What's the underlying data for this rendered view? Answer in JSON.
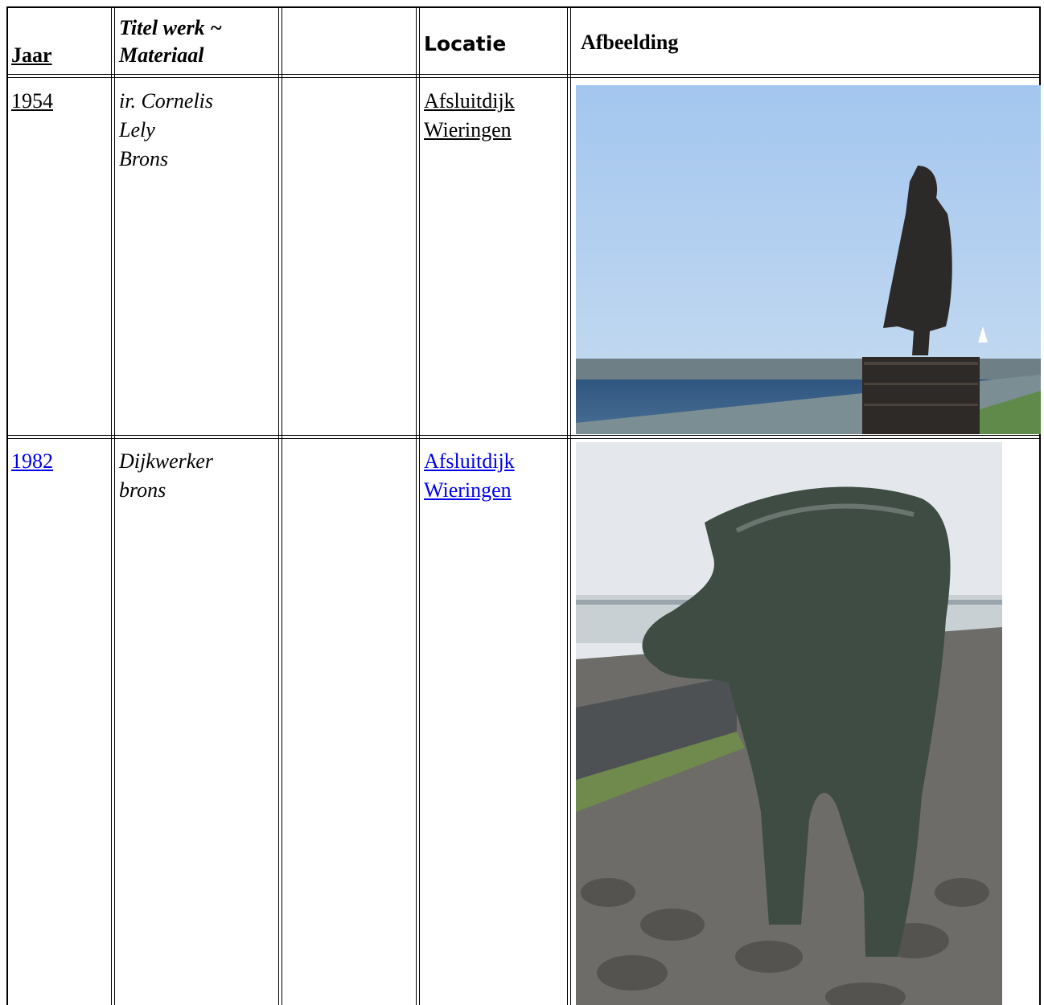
{
  "header": {
    "jaar": "Jaar",
    "titel_line1": "Titel werk ~",
    "titel_line2": "Materiaal",
    "empty": "",
    "locatie": "Locatie",
    "afbeelding": "Afbeelding"
  },
  "rows": [
    {
      "jaar": "1954",
      "titel": [
        "ir. Cornelis",
        "Lely",
        "Brons"
      ],
      "locatie": [
        "Afsluitdijk",
        "Wieringen"
      ],
      "image": "statue-lely-photo"
    },
    {
      "jaar": "1982",
      "titel": [
        "Dijkwerker",
        "brons"
      ],
      "locatie": [
        "Afsluitdijk",
        "Wieringen"
      ],
      "image": "statue-dijkwerker-photo"
    }
  ],
  "colors": {
    "link": "#0000ee",
    "sky": "#a9cbef",
    "water": "#3a5f85",
    "bronze": "#3c4a40"
  }
}
